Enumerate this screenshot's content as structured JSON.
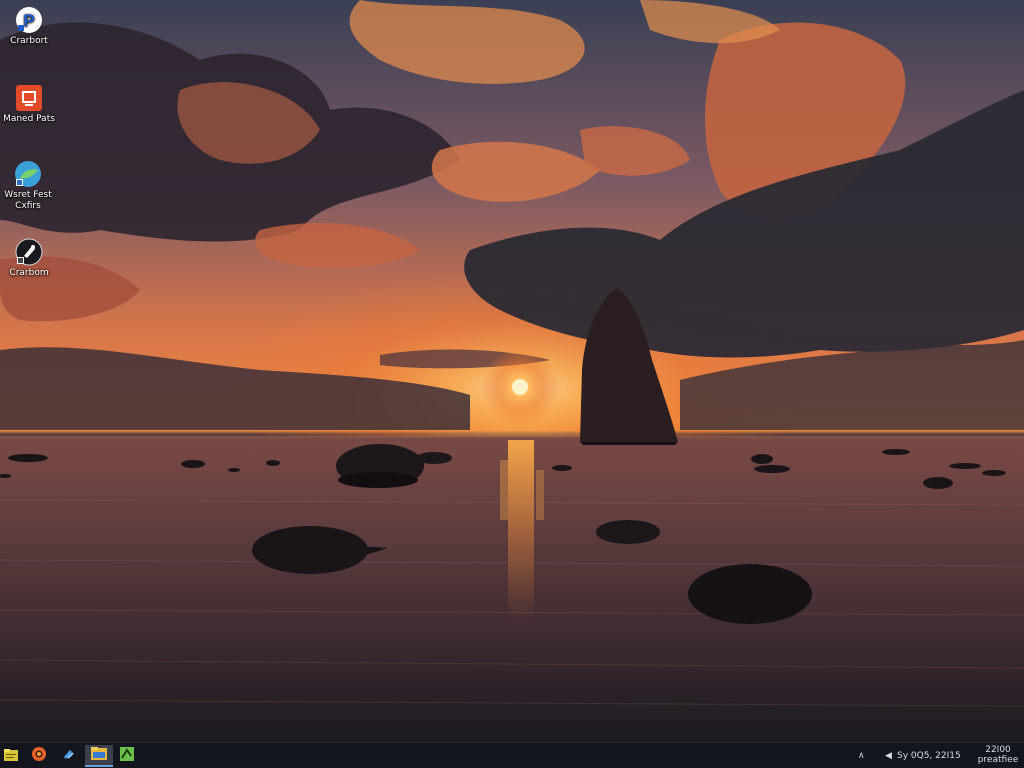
{
  "desktop": {
    "icons": [
      {
        "label": "Crarbort",
        "icon": "p-app-icon"
      },
      {
        "label": "Maned Pats",
        "icon": "document-app-icon"
      },
      {
        "label": "Wsret Fest\nCxfirs",
        "icon": "globe-app-icon"
      },
      {
        "label": "Crarbom",
        "icon": "player-app-icon"
      }
    ]
  },
  "taskbar": {
    "buttons": [
      {
        "name": "notes-icon"
      },
      {
        "name": "browser-icon"
      },
      {
        "name": "bluetooth-icon"
      },
      {
        "name": "file-explorer-icon"
      },
      {
        "name": "tiles-app-icon"
      }
    ],
    "tray": {
      "status_text": "Sy 0Q5, 22I15",
      "clock_time": "22I00",
      "clock_label": "preatfiee"
    }
  },
  "colors": {
    "taskbar_bg": "#14161d",
    "accent": "#6aa0e0"
  }
}
